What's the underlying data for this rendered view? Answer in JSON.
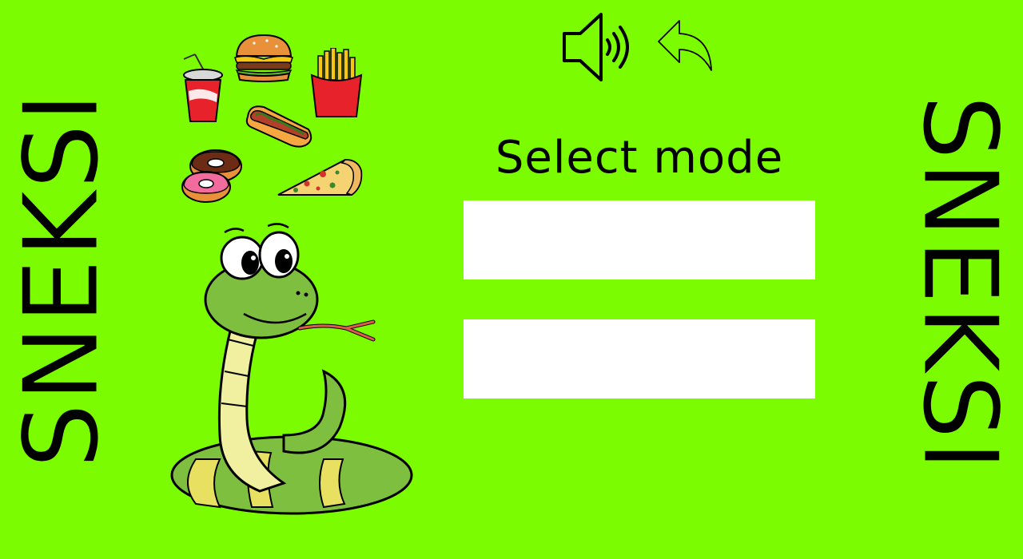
{
  "game": {
    "title_left": "SNEKSI",
    "title_right": "SNEKSI"
  },
  "menu": {
    "heading": "Select mode",
    "mode_buttons": [
      {
        "label": ""
      },
      {
        "label": ""
      }
    ]
  },
  "controls": {
    "sound_icon": "speaker-volume-icon",
    "back_icon": "back-arrow-icon"
  },
  "decorations": {
    "foods": [
      "soda-cup-icon",
      "burger-icon",
      "fries-icon",
      "hotdog-icon",
      "donuts-icon",
      "pizza-slice-icon"
    ],
    "mascot": "snake-mascot"
  },
  "colors": {
    "background": "#7cfc00",
    "button": "#ffffff",
    "text": "#000000"
  }
}
